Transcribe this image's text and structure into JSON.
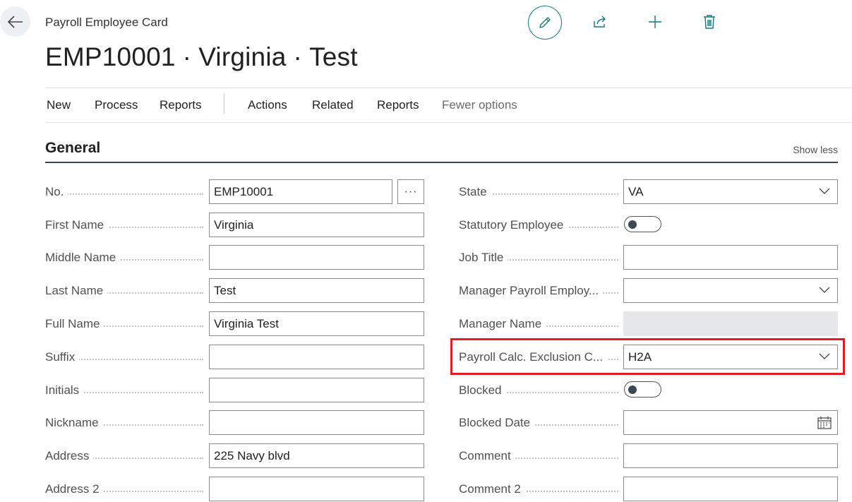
{
  "header": {
    "caption": "Payroll Employee Card",
    "title_no": "EMP10001",
    "title_first": "Virginia",
    "title_last": "Test",
    "title_sep": "·"
  },
  "top_actions": {
    "edit_icon": "pencil-icon",
    "share_icon": "share-icon",
    "add_icon": "plus-icon",
    "delete_icon": "trash-icon",
    "accent_color": "#0f7c7c"
  },
  "menu": {
    "items": [
      "New",
      "Process",
      "Reports",
      "Actions",
      "Related",
      "Reports",
      "Fewer options"
    ]
  },
  "section": {
    "title": "General",
    "toggle_label": "Show less"
  },
  "left_fields": [
    {
      "label": "No.",
      "value": "EMP10001",
      "lookup": "···"
    },
    {
      "label": "First Name",
      "value": "Virginia"
    },
    {
      "label": "Middle Name",
      "value": ""
    },
    {
      "label": "Last Name",
      "value": "Test"
    },
    {
      "label": "Full Name",
      "value": "Virginia Test"
    },
    {
      "label": "Suffix",
      "value": ""
    },
    {
      "label": "Initials",
      "value": ""
    },
    {
      "label": "Nickname",
      "value": ""
    },
    {
      "label": "Address",
      "value": "225 Navy blvd"
    },
    {
      "label": "Address 2",
      "value": ""
    }
  ],
  "right_fields": [
    {
      "label": "State",
      "value": "VA",
      "type": "dropdown"
    },
    {
      "label": "Statutory Employee",
      "value": "off",
      "type": "toggle"
    },
    {
      "label": "Job Title",
      "value": "",
      "type": "text"
    },
    {
      "label": "Manager Payroll Employ...",
      "value": "",
      "type": "dropdown"
    },
    {
      "label": "Manager Name",
      "value": "",
      "type": "disabled"
    },
    {
      "label": "Payroll Calc. Exclusion C...",
      "value": "H2A",
      "type": "dropdown",
      "highlighted": true
    },
    {
      "label": "Blocked",
      "value": "off",
      "type": "toggle"
    },
    {
      "label": "Blocked Date",
      "value": "",
      "type": "date"
    },
    {
      "label": "Comment",
      "value": "",
      "type": "text"
    },
    {
      "label": "Comment 2",
      "value": "",
      "type": "text"
    }
  ],
  "highlight_color": "#e31b23"
}
